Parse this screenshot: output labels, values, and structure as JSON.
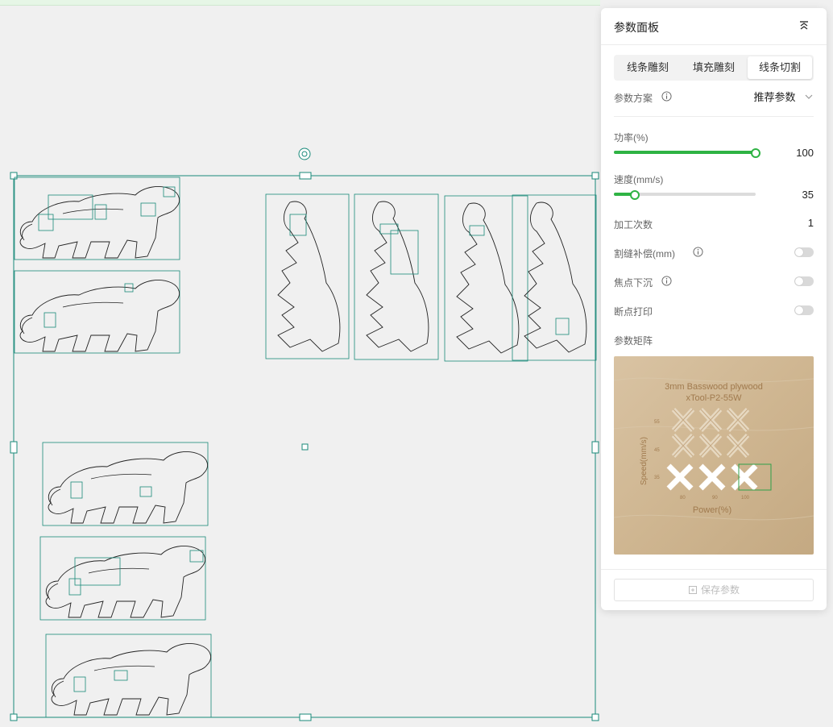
{
  "panel": {
    "title": "参数面板",
    "tabs": [
      {
        "label": "线条雕刻",
        "active": false
      },
      {
        "label": "填充雕刻",
        "active": false
      },
      {
        "label": "线条切割",
        "active": true
      }
    ],
    "preset": {
      "label": "参数方案",
      "value": "推荐参数"
    },
    "power": {
      "label": "功率(%)",
      "value": "100",
      "fraction": 1.0
    },
    "speed": {
      "label": "速度(mm/s)",
      "value": "35",
      "fraction": 0.15
    },
    "passes": {
      "label": "加工次数",
      "value": "1"
    },
    "kerf": {
      "label": "割缝补偿(mm)",
      "enabled": false
    },
    "focus_drop": {
      "label": "焦点下沉",
      "enabled": false
    },
    "breakpoint_print": {
      "label": "断点打印",
      "enabled": false
    },
    "matrix": {
      "label": "参数矩阵",
      "title_line1": "3mm  Basswood plywood",
      "title_line2": "xTool-P2-55W",
      "y_axis": "Speed(mm/s)",
      "x_axis": "Power(%)",
      "y_ticks": [
        "55",
        "45",
        "35"
      ],
      "x_ticks": [
        "80",
        "90",
        "100"
      ]
    },
    "save_label": "保存参数"
  },
  "colors": {
    "accent": "#2fb344",
    "selection": "#1a8a7a",
    "object_outline": "#1a8a7a"
  }
}
